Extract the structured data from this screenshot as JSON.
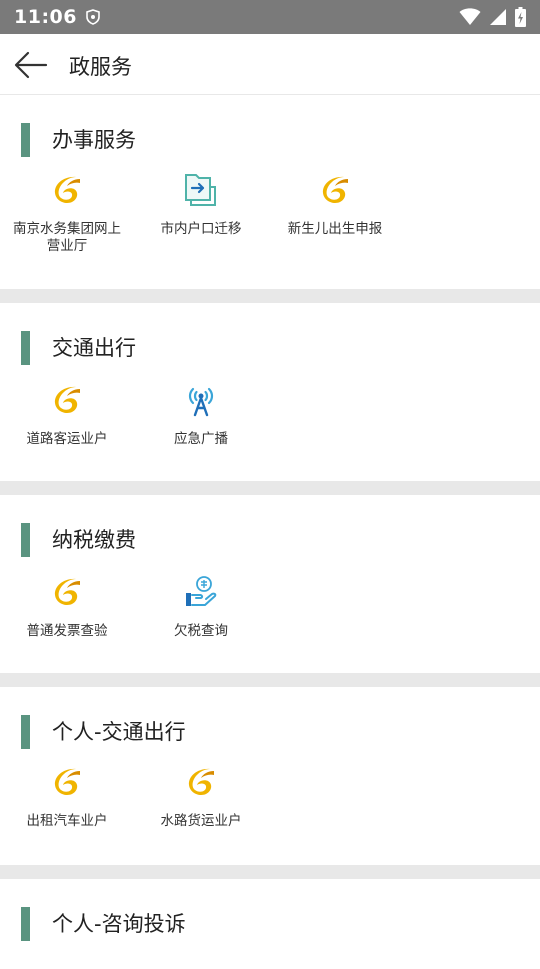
{
  "status_bar": {
    "time": "11:06"
  },
  "app_bar": {
    "title": "政服务"
  },
  "sections": [
    {
      "title": "办事服务",
      "items": [
        {
          "label": "南京水务集团网上营业厅",
          "icon": "swirl-logo-icon"
        },
        {
          "label": "市内户口迁移",
          "icon": "folder-transfer-icon"
        },
        {
          "label": "新生儿出生申报",
          "icon": "swirl-logo-icon"
        }
      ]
    },
    {
      "title": "交通出行",
      "items": [
        {
          "label": "道路客运业户",
          "icon": "swirl-logo-icon"
        },
        {
          "label": "应急广播",
          "icon": "broadcast-tower-icon"
        }
      ]
    },
    {
      "title": "纳税缴费",
      "items": [
        {
          "label": "普通发票查验",
          "icon": "swirl-logo-icon"
        },
        {
          "label": "欠税查询",
          "icon": "tax-hand-icon"
        }
      ]
    },
    {
      "title": "个人-交通出行",
      "items": [
        {
          "label": "出租汽车业户",
          "icon": "swirl-logo-icon"
        },
        {
          "label": "水路货运业户",
          "icon": "swirl-logo-icon"
        }
      ]
    },
    {
      "title": "个人-咨询投诉",
      "items": []
    }
  ],
  "colors": {
    "accent": "#5a9480",
    "status_bar": "#7a7a7a",
    "divider": "#e8e8e8",
    "swirl": "#f0b400"
  }
}
